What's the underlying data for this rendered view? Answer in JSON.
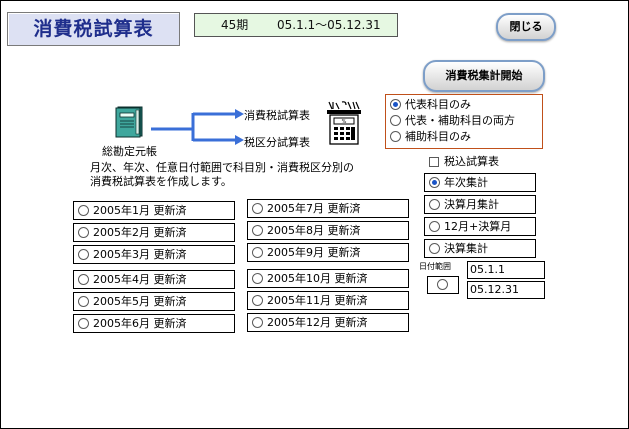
{
  "header": {
    "title": "消費税試算表",
    "period_num": "45期",
    "period_range": "05.1.1～05.12.31"
  },
  "buttons": {
    "close": "閉じる",
    "start": "消費税集計開始"
  },
  "flow": {
    "ledger_label": "総勘定元帳",
    "output_1": "消費税試算表",
    "output_2": "税区分試算表"
  },
  "description": [
    "月次、年次、任意日付範囲で科目別・消費税区分別の",
    "消費税試算表を作成します。"
  ],
  "subject_options": {
    "selected": 0,
    "items": [
      "代表科目のみ",
      "代表・補助科目の両方",
      "補助科目のみ"
    ]
  },
  "tax_checkbox": {
    "label": "税込試算表",
    "checked": false
  },
  "period_options": {
    "selected": 0,
    "items": [
      "年次集計",
      "決算月集計",
      "12月+決算月",
      "決算集計"
    ]
  },
  "date_range": {
    "label": "日付範囲",
    "from": "05.1.1",
    "to": "05.12.31"
  },
  "months": [
    "2005年1月 更新済",
    "2005年2月 更新済",
    "2005年3月 更新済",
    "2005年4月 更新済",
    "2005年5月 更新済",
    "2005年6月 更新済",
    "2005年7月 更新済",
    "2005年8月 更新済",
    "2005年9月 更新済",
    "2005年10月 更新済",
    "2005年11月 更新済",
    "2005年12月 更新済"
  ],
  "colors": {
    "title_text": "#1f2e8c",
    "title_bg": "#dde1f3",
    "period_bg": "#e6f8e2",
    "group_border": "#c0501a",
    "arrow": "#3a6fd8",
    "radio_dot": "#1a54c6"
  },
  "icons": {
    "ledger": "ledger-book-icon",
    "calc": "taxman-calculator-icon"
  }
}
